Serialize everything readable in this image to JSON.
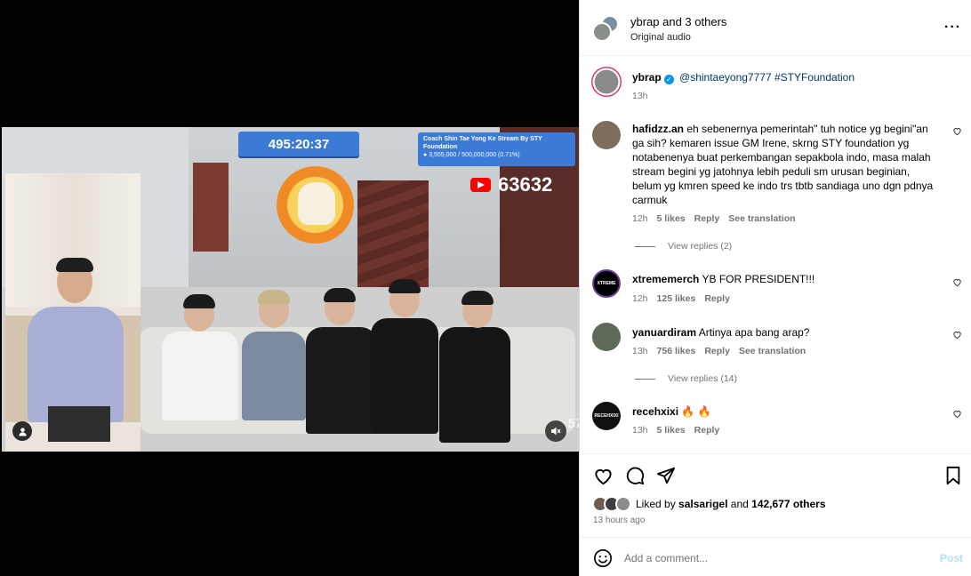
{
  "video": {
    "timer": "495:20:37",
    "donation_title": "Coach Shin Tae Yong Ke Stream By STY Foundation",
    "donation_amount": "3,555,000 / 500,000,000 (0.71%)",
    "viewer_count": "63632",
    "side_count": "57"
  },
  "header": {
    "title": "ybrap and 3 others",
    "audio": "Original audio"
  },
  "caption": {
    "username": "ybrap",
    "mention": "@shintaeyong7777",
    "hashtag": "#STYFoundation",
    "time": "13h"
  },
  "comments": [
    {
      "username": "hafidzz.an",
      "text": "eh sebenernya pemerintah\" tuh notice yg begini\"an ga sih? kemaren issue GM Irene, skrng STY foundation yg notabenenya buat perkembangan sepakbola indo, masa malah stream begini yg jatohnya lebih peduli sm urusan beginian, belum yg kmren speed ke indo trs tbtb sandiaga uno dgn pdnya carmuk",
      "time": "12h",
      "likes": "5 likes",
      "reply": "Reply",
      "translate": "See translation",
      "view_replies": "View replies (2)"
    },
    {
      "username": "xtrememerch",
      "text": "YB FOR PRESIDENT!!!",
      "avatar_label": "XTREME",
      "time": "12h",
      "likes": "125 likes",
      "reply": "Reply"
    },
    {
      "username": "yanuardiram",
      "text": "Artinya apa bang arap?",
      "time": "13h",
      "likes": "756 likes",
      "reply": "Reply",
      "translate": "See translation",
      "view_replies": "View replies (14)"
    },
    {
      "username": "recehxixi",
      "text": "🔥 🔥",
      "avatar_label": "RECEHXIXI",
      "time": "13h",
      "likes": "5 likes",
      "reply": "Reply"
    }
  ],
  "likes_summary": {
    "prefix": "Liked by",
    "user": "salsarigel",
    "middle": "and",
    "others": "142,677 others",
    "time_ago": "13 hours ago"
  },
  "add_comment": {
    "placeholder": "Add a comment...",
    "post_label": "Post"
  },
  "icons": {
    "more": "more-icon",
    "like": "heart-icon",
    "comment": "comment-icon",
    "share": "share-icon",
    "save": "bookmark-icon",
    "emoji": "emoji-icon"
  },
  "colors": {
    "accent": "#0095f6",
    "overlay_blue": "#3b7bd6",
    "post_disabled": "#b2dffc"
  }
}
